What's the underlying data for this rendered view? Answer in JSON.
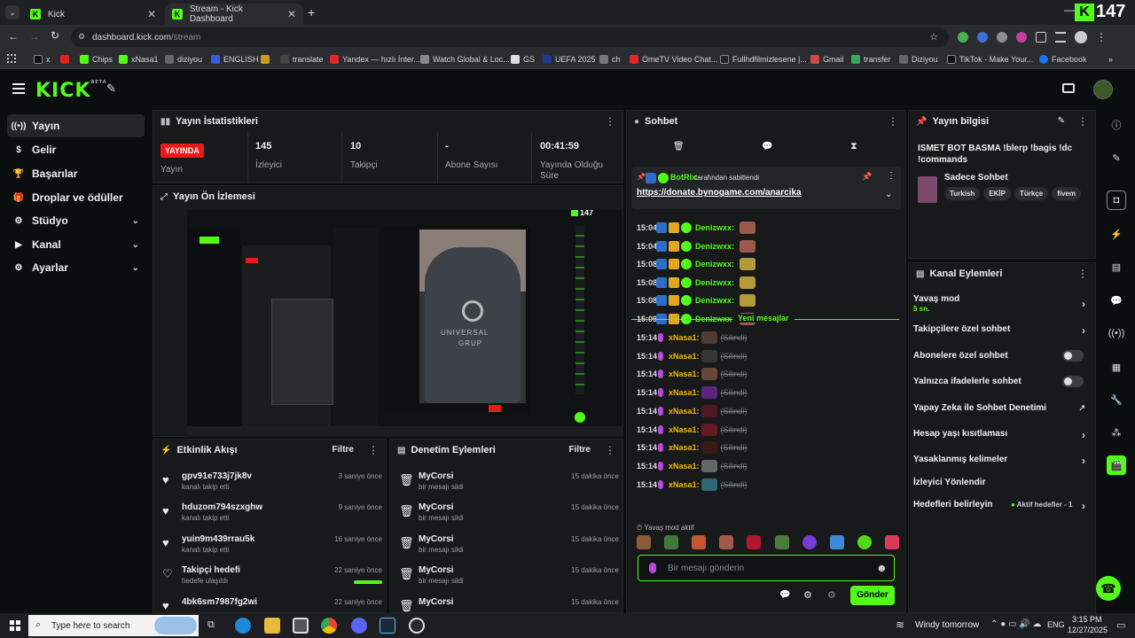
{
  "browser": {
    "tabs": [
      {
        "label": "Kick",
        "active": false
      },
      {
        "label": "Stream - Kick Dashboard",
        "active": true
      }
    ],
    "url_host": "dashboard.kick.com",
    "url_path": "/stream",
    "bookmarks": [
      "x",
      "Chips",
      "xNasa1",
      "diziyou",
      "ENGLISH",
      "translate",
      "Yandex — hızlı İnter...",
      "Watch Global & Loc...",
      "GS",
      "UEFA 2025",
      "ch",
      "OmeTV Video Chat...",
      "Fullhdfilmizlesene |...",
      "Gmail",
      "transfer",
      "Diziyou",
      "TikTok - Make Your...",
      "Facebook"
    ],
    "overlay_count": "147"
  },
  "kick": {
    "logo": "KICK",
    "logo_sup": "BETA"
  },
  "sidebar": {
    "items": [
      {
        "label": "Yayın",
        "icon": "broadcast-icon"
      },
      {
        "label": "Gelir",
        "icon": "dollar-icon"
      },
      {
        "label": "Başarılar",
        "icon": "trophy-icon"
      },
      {
        "label": "Droplar ve ödüller",
        "icon": "gift-icon"
      },
      {
        "label": "Stüdyo",
        "icon": "studio-icon"
      },
      {
        "label": "Kanal",
        "icon": "channel-icon"
      },
      {
        "label": "Ayarlar",
        "icon": "settings-icon"
      }
    ]
  },
  "stats": {
    "title": "Yayın İstatistikleri",
    "live_badge": "YAYINDA",
    "live_label": "Yayın",
    "viewers": "145",
    "viewers_label": "İzleyici",
    "followers": "10",
    "followers_label": "Takipçi",
    "subs": "-",
    "subs_label": "Abone Sayısı",
    "duration": "00:41:59",
    "duration_label": "Yayında Olduğu Süre"
  },
  "preview": {
    "title": "Yayın Ön İzlemesi",
    "overlay_count": "147",
    "hoodie_text_1": "UNIVERSAL",
    "hoodie_text_2": "GRUP"
  },
  "activity": {
    "title": "Etkinlik Akışı",
    "filter": "Filtre",
    "items": [
      {
        "name": "gpv91e733j7jk8v",
        "sub": "kanalı takip etti",
        "time": "3 saniye önce"
      },
      {
        "name": "hduzom794szxghw",
        "sub": "kanalı takip etti",
        "time": "9 saniye önce"
      },
      {
        "name": "yuin9m439rrau5k",
        "sub": "kanalı takip etti",
        "time": "16 saniye önce"
      },
      {
        "name": "Takipçi hedefi",
        "sub": "hedefe ulaşıldı",
        "time": "22 saniye önce"
      },
      {
        "name": "4bk6sm7987fg2wi",
        "sub": "",
        "time": "22 saniye önce"
      }
    ]
  },
  "moderation": {
    "title": "Denetim Eylemleri",
    "filter": "Filtre",
    "items": [
      {
        "name": "MyCorsi",
        "sub": "bir mesajı sildi",
        "time": "15 dakika önce"
      },
      {
        "name": "MyCorsi",
        "sub": "bir mesajı sildi",
        "time": "15 dakika önce"
      },
      {
        "name": "MyCorsi",
        "sub": "bir mesajı sildi",
        "time": "15 dakika önce"
      },
      {
        "name": "MyCorsi",
        "sub": "bir mesajı sildi",
        "time": "15 dakika önce"
      },
      {
        "name": "MyCorsi",
        "sub": "",
        "time": "15 dakika önce"
      }
    ]
  },
  "chat": {
    "title": "Sohbet",
    "pinned_by": "BotRix",
    "pinned_suffix": "tarafından sabitlendi",
    "pinned_link": "https://donate.bynogame.com/anarcika",
    "old_messages": [
      {
        "time": "15:04",
        "user": "Denizwxx:"
      },
      {
        "time": "15:04",
        "user": "Denizwxx:"
      },
      {
        "time": "15:08",
        "user": "Denizwxx:"
      },
      {
        "time": "15:08",
        "user": "Denizwxx:"
      },
      {
        "time": "15:08",
        "user": "Denizwxx:"
      },
      {
        "time": "15:09",
        "user": "Denizwxx:"
      }
    ],
    "new_messages_label": "Yeni mesajlar",
    "new_messages": [
      {
        "time": "15:14",
        "user": "xNasa1:",
        "text": "(Silindi)"
      },
      {
        "time": "15:14",
        "user": "xNasa1:",
        "text": "(Silindi)"
      },
      {
        "time": "15:14",
        "user": "xNasa1:",
        "text": "(Silindi)"
      },
      {
        "time": "15:14",
        "user": "xNasa1:",
        "text": "(Silindi)"
      },
      {
        "time": "15:14",
        "user": "xNasa1:",
        "text": "(Silindi)"
      },
      {
        "time": "15:14",
        "user": "xNasa1:",
        "text": "(Silindi)"
      },
      {
        "time": "15:14",
        "user": "xNasa1:",
        "text": "(Silindi)"
      },
      {
        "time": "15:14",
        "user": "xNasa1:",
        "text": "(Silindi)"
      },
      {
        "time": "15:14",
        "user": "xNasa1:",
        "text": "(Silindi)"
      }
    ],
    "slow_mode": "Yavaş mod aktif",
    "placeholder": "Bir mesajı gönderin",
    "send": "Gönder"
  },
  "stream_info": {
    "title": "Yayın bilgisi",
    "stream_title": "ISMET BOT BASMA !blerp !bagis !dc !commands",
    "category": "Sadece Sohbet",
    "tags": [
      "Turkish",
      "EKİP",
      "Türkçe",
      "fivem"
    ]
  },
  "channel_actions": {
    "title": "Kanal Eylemleri",
    "items": [
      {
        "label": "Yavaş mod",
        "sub": "5 sn.",
        "type": "chevron"
      },
      {
        "label": "Takipçilere özel sohbet",
        "type": "chevron"
      },
      {
        "label": "Abonelere özel sohbet",
        "type": "toggle"
      },
      {
        "label": "Yalnızca ifadelerle sohbet",
        "type": "toggle"
      },
      {
        "label": "Yapay Zeka ile Sohbet Denetimi",
        "type": "external"
      },
      {
        "label": "Hesap yaşı kısıtlaması",
        "type": "chevron"
      },
      {
        "label": "Yasaklanmış kelimeler",
        "type": "chevron"
      },
      {
        "label": "İzleyici Yönlendir",
        "type": "none"
      },
      {
        "label": "Hedefleri belirleyin",
        "type": "goal",
        "extra": "Aktif hedefler - 1"
      }
    ]
  },
  "taskbar": {
    "search": "Type here to search",
    "weather": "Windy tomorrow",
    "lang": "ENG",
    "time": "3:15 PM",
    "date": "12/27/2025"
  },
  "colors": {
    "accent": "#53fc18",
    "live": "#e91916",
    "username_mod": "#53fc18",
    "deleted": "#7c7c7c"
  }
}
